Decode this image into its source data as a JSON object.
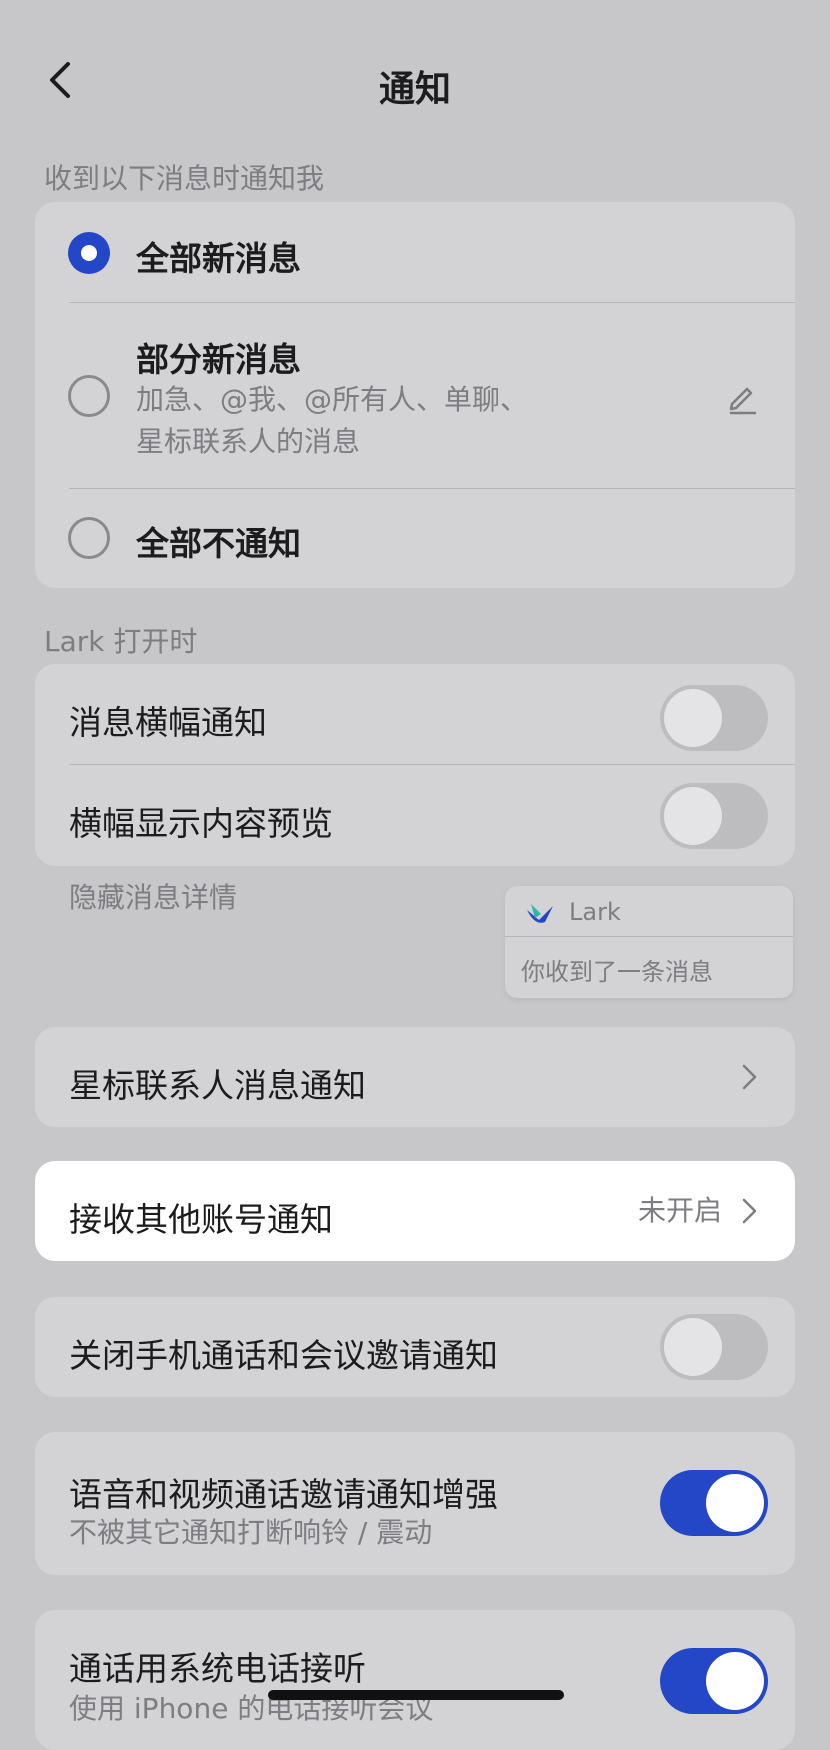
{
  "header": {
    "title": "通知"
  },
  "notify_section": {
    "label": "收到以下消息时通知我",
    "options": [
      {
        "label": "全部新消息",
        "selected": true
      },
      {
        "label": "部分新消息",
        "sub": "加急、@我、@所有人、单聊、星标联系人的消息",
        "selected": false
      },
      {
        "label": "全部不通知",
        "selected": false
      }
    ]
  },
  "lark_open_section": {
    "label": "Lark 打开时",
    "banner": {
      "label": "消息横幅通知",
      "on": false
    },
    "preview": {
      "label": "横幅显示内容预览",
      "on": false
    },
    "hint": "隐藏消息详情",
    "sample": {
      "app": "Lark",
      "message": "你收到了一条消息"
    }
  },
  "starred": {
    "label": "星标联系人消息通知"
  },
  "other_accounts": {
    "label": "接收其他账号通知",
    "value": "未开启"
  },
  "close_calls": {
    "label": "关闭手机通话和会议邀请通知",
    "on": false
  },
  "enhance": {
    "label": "语音和视频通话邀请通知增强",
    "sub": "不被其它通知打断响铃 / 震动",
    "on": true
  },
  "system_call": {
    "label": "通话用系统电话接听",
    "sub": "使用 iPhone 的电话接听会议",
    "on": true
  },
  "colors": {
    "accent": "#2447c7",
    "background": "#c7c7c9",
    "card": "#d3d3d5"
  }
}
